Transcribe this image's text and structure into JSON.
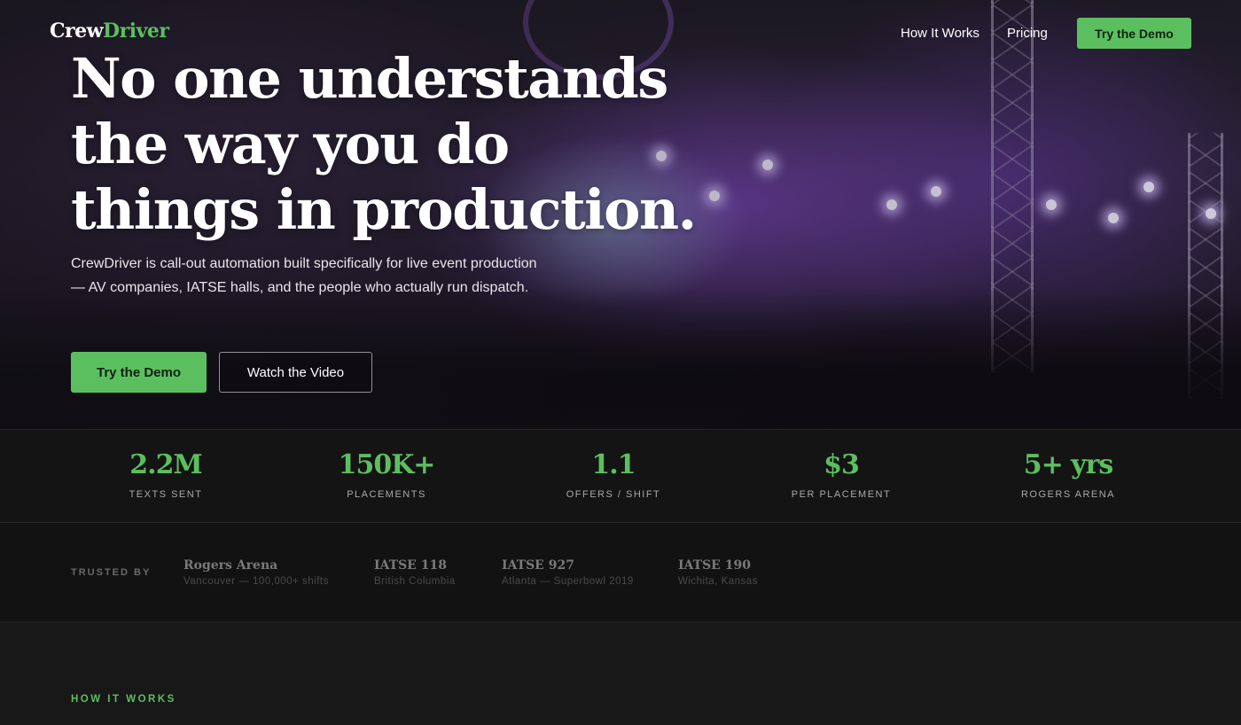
{
  "brand": {
    "name_part1": "Crew",
    "name_part2": "Driver",
    "accent_color": "#5cbf5f"
  },
  "nav": {
    "links": [
      {
        "label": "How It Works"
      },
      {
        "label": "Pricing"
      }
    ],
    "cta_label": "Try the Demo"
  },
  "hero": {
    "headline_lines": [
      "No one understands",
      "the way you do",
      "things in production."
    ],
    "subtext": "CrewDriver is call-out automation built specifically for live event production — AV companies, IATSE halls, and the people who actually run dispatch.",
    "primary_cta": "Try the Demo",
    "secondary_cta": "Watch the Video"
  },
  "stats": [
    {
      "value": "2.2M",
      "label": "TEXTS SENT"
    },
    {
      "value": "150K+",
      "label": "PLACEMENTS"
    },
    {
      "value": "1.1",
      "label": "OFFERS / SHIFT"
    },
    {
      "value": "$3",
      "label": "PER PLACEMENT"
    },
    {
      "value": "5+ yrs",
      "label": "ROGERS ARENA"
    }
  ],
  "trusted": {
    "label": "TRUSTED BY",
    "clients": [
      {
        "name": "Rogers Arena",
        "sub": "Vancouver — 100,000+ shifts"
      },
      {
        "name": "IATSE 118",
        "sub": "British Columbia"
      },
      {
        "name": "IATSE 927",
        "sub": "Atlanta — Superbowl 2019"
      },
      {
        "name": "IATSE 190",
        "sub": "Wichita, Kansas"
      }
    ]
  },
  "how_it_works": {
    "label": "HOW IT WORKS"
  }
}
